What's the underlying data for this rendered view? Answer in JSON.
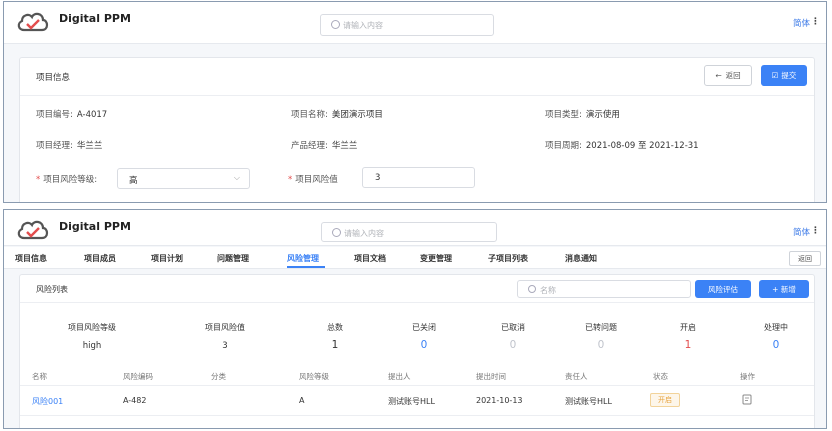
{
  "app": {
    "brand": "Digital PPM",
    "search_placeholder": "请输入内容",
    "language": "简体",
    "more": "⋮"
  },
  "colors": {
    "accent": "#3b82f6",
    "required": "#e34d4d",
    "status_open": "#e6a23c",
    "stat_blue": "#3b82f6",
    "stat_red": "#e34d4d",
    "stat_muted": "#c0c4cc"
  },
  "project": {
    "title": "项目信息",
    "back_label": "返回",
    "submit_label": "提交",
    "fields": {
      "code": {
        "label": "项目编号:",
        "value": "A-4017"
      },
      "name": {
        "label": "项目名称:",
        "value": "美团演示项目"
      },
      "type": {
        "label": "项目类型:",
        "value": "演示使用"
      },
      "manager": {
        "label": "项目经理:",
        "value": "华兰兰"
      },
      "product_manager": {
        "label": "产品经理:",
        "value": "华兰兰"
      },
      "period": {
        "label": "项目周期:",
        "value": "2021-08-09 至 2021-12-31"
      },
      "risk_level": {
        "label": "项目风险等级:",
        "value": "高"
      },
      "risk_value": {
        "label": "项目风险值",
        "value": "3"
      }
    }
  },
  "tabs": [
    "项目信息",
    "项目成员",
    "项目计划",
    "问题管理",
    "风险管理",
    "项目文档",
    "变更管理",
    "子项目列表",
    "消息通知"
  ],
  "active_tab": "风险管理",
  "tab_back_label": "返回",
  "risk": {
    "title": "风险列表",
    "search_placeholder": "名称",
    "eval_label": "风险评估",
    "add_label": "+ 新增",
    "stats": [
      {
        "label": "项目风险等级",
        "value": "high"
      },
      {
        "label": "项目风险值",
        "value": "3"
      },
      {
        "label": "总数",
        "value": "1"
      },
      {
        "label": "已关闭",
        "value": "0"
      },
      {
        "label": "已取消",
        "value": "0"
      },
      {
        "label": "已转问题",
        "value": "0"
      },
      {
        "label": "开启",
        "value": "1"
      },
      {
        "label": "处理中",
        "value": "0"
      }
    ],
    "columns": [
      "名称",
      "风险编码",
      "分类",
      "风险等级",
      "提出人",
      "提出时间",
      "责任人",
      "状态",
      "操作"
    ],
    "rows": [
      {
        "name": "风险001",
        "code": "A-482",
        "category": "",
        "level": "A",
        "proposer": "测试账号HLL",
        "time": "2021-10-13",
        "owner": "测试账号HLL",
        "status": "开启"
      }
    ]
  }
}
